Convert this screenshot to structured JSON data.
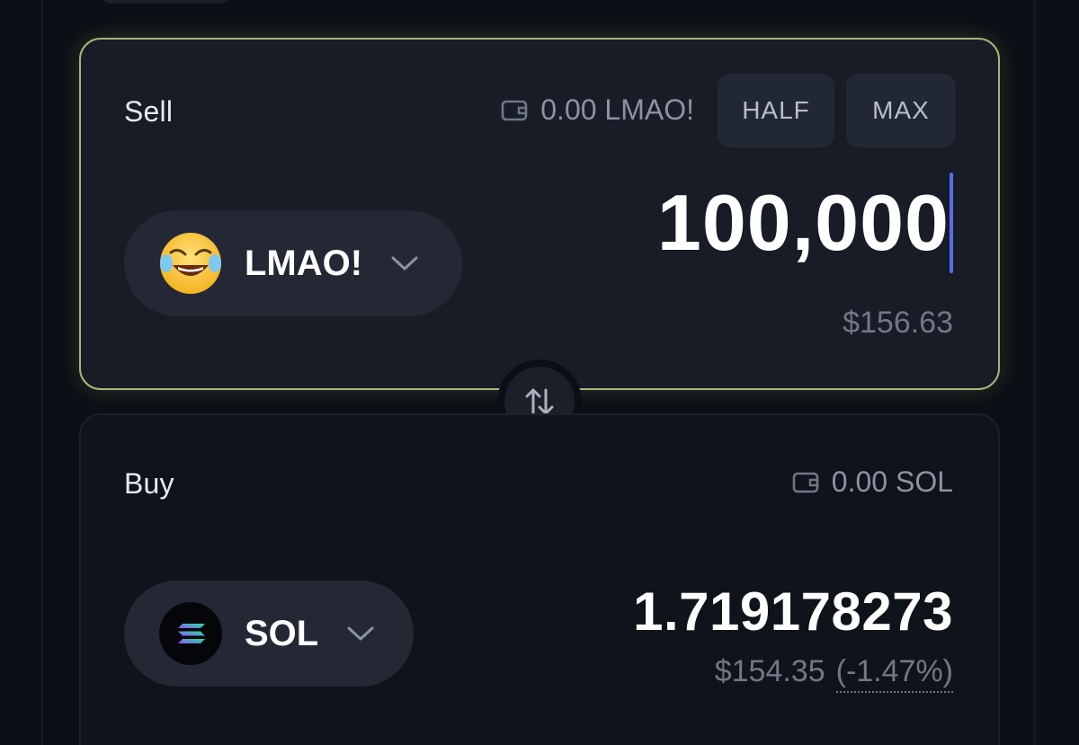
{
  "sell": {
    "label": "Sell",
    "balance": "0.00 LMAO!",
    "half_label": "HALF",
    "max_label": "MAX",
    "token_symbol": "LMAO!",
    "token_icon": "laughing-face-emoji",
    "amount": "100,000",
    "usd_value": "$156.63"
  },
  "buy": {
    "label": "Buy",
    "balance": "0.00 SOL",
    "token_symbol": "SOL",
    "token_icon": "solana-logo",
    "amount": "1.719178273",
    "usd_value": "$154.35",
    "change": "(-1.47%)"
  },
  "swap": {
    "icon": "swap-arrows-icon"
  },
  "colors": {
    "sell_card_border": "#a3b87a",
    "caret": "#5b6cf0",
    "background": "#0c0f15"
  }
}
